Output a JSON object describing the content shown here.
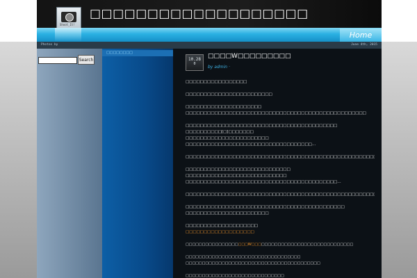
{
  "site": {
    "title": "□□□□□□□□□□□□□□□□□□□",
    "logo_caption": "Shoot_It!"
  },
  "nav": {
    "home_label": "Home"
  },
  "subbar": {
    "left_text": "Photos by",
    "right_text": "June 4th, 2015"
  },
  "search": {
    "value": "",
    "button_label": "Search"
  },
  "sidebar": {
    "category_header": "□□□□□□□□"
  },
  "post": {
    "date_line1": "10.28",
    "date_line2": "0",
    "title": "□□□□W□□□□□□□□□",
    "meta": "by admin ·",
    "paragraphs": [
      [
        "□□□□□□□□□□□□□□□□□"
      ],
      [
        "□□□□□□□□□□□□□□□□□□□□□□□□"
      ],
      [
        "□□□□□□□□□□□□□□□□□□□□□",
        "□□□□□□□□□□□□□□□□□□□□□□□□□□□□□□□□□□□□□□□□□□□□□□□□□□"
      ],
      [
        "□□□□□□□□□□□□□□□□□□□□□□□□□□□□□□□□□□□□□□□□□□",
        "□□□□□□□□□□[□]□□□□□□□",
        "□□□□□□□□□□□□□□□□□□□□□□□",
        "□□□□□□□□□□□□□□□□□□□□□□□□□□□□□□□□□□□…"
      ],
      [
        "□□□□□□□□□□□□□□□□□□□□□□□□□□□□□□□□□□□□□□□□□□□□□□□□□□□□□□□□□□□"
      ],
      [
        "□□□□□□□□□□□□□□□□□□□□□□□□□□□□□",
        "□□□□□□□□□□□□□□□□□□□□□□□□□□□□",
        "□□□□□□□□□□□□□□□□□□□□□□□□□□□□□□□□□□□□□□□□□□…"
      ],
      [
        "□□□□□□□□□□□□□□□□□□□□□□□□□□□□□□□□□□□□□□□□□□□□□□□□□□□□□□□□"
      ],
      [
        "□□□□□□□□□□□□□□□□□□□□□□□□□□□□□□□□□□□□□□□□□□□□",
        "□□□□□□□□□□□□□□□□□□□□□□□"
      ],
      [
        "□□□□□□□□□□□□□□□□□□□□"
      ]
    ],
    "link_text": "□□□□□□□□□□□□□□□□□□□",
    "small_line_before_link": "□□□□□□□□□□□□□□□□",
    "small_link_inline": "□□□W□□□",
    "small_line_after_link": "□□□□□□□□□□□□□□□□□□□□□□□□□□□□",
    "small_para_2": [
      "□□□□□□□□□□□□□□□□□□□□□□□□□□□□□□□□□□□",
      "□□□□□□□□□□□□□□□□□□□□□□□□□□□□□□□□□□□□□□□□□"
    ],
    "small_para_3": [
      "□□□□□□□□□□□□□□□□□□□□□□□□□□□□□□"
    ]
  }
}
